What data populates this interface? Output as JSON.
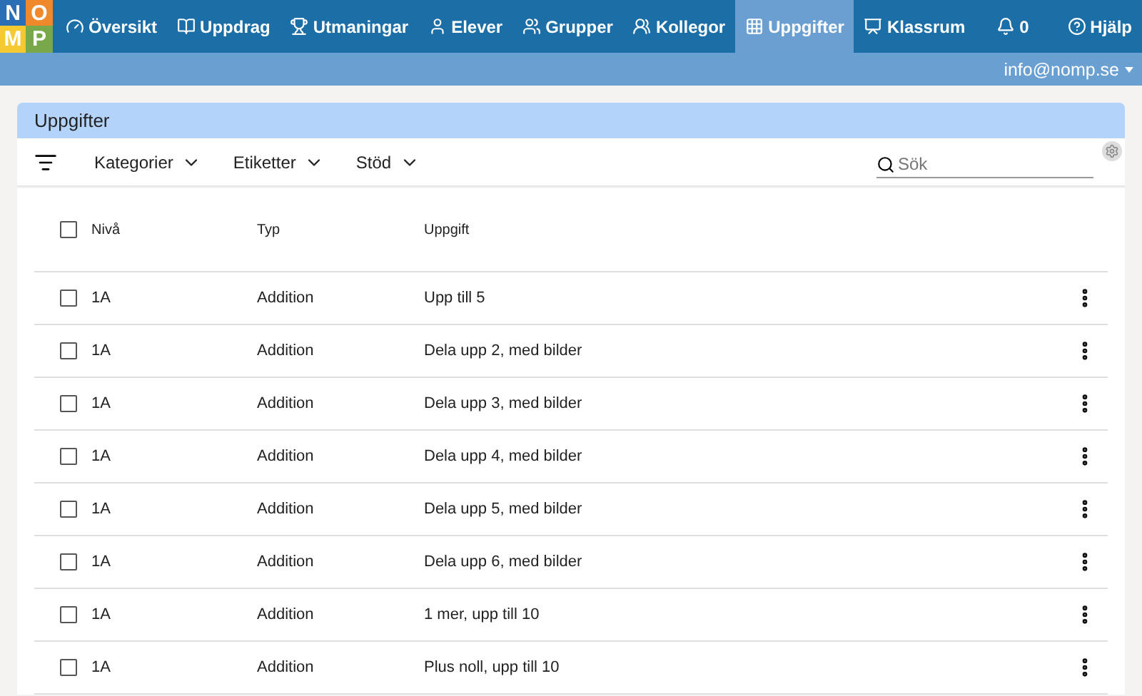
{
  "logo": {
    "letters": [
      "N",
      "O",
      "M",
      "P"
    ]
  },
  "nav": {
    "items": [
      {
        "label": "Översikt",
        "selected": false
      },
      {
        "label": "Uppdrag",
        "selected": false
      },
      {
        "label": "Utmaningar",
        "selected": false
      },
      {
        "label": "Elever",
        "selected": false
      },
      {
        "label": "Grupper",
        "selected": false
      },
      {
        "label": "Kollegor",
        "selected": false
      },
      {
        "label": "Uppgifter",
        "selected": true
      },
      {
        "label": "Klassrum",
        "selected": false
      },
      {
        "label": "0",
        "selected": false
      }
    ],
    "help": "Hjälp"
  },
  "account": "info@nomp.se",
  "panel": {
    "title": "Uppgifter",
    "filters": [
      "Kategorier",
      "Etiketter",
      "Stöd"
    ],
    "search": {
      "placeholder": "Sök"
    }
  },
  "table": {
    "columns": [
      "Nivå",
      "Typ",
      "Uppgift"
    ],
    "all_checked": false,
    "rows": [
      {
        "level": "1A",
        "type": "Addition",
        "task": "Upp till 5",
        "checked": false
      },
      {
        "level": "1A",
        "type": "Addition",
        "task": "Dela upp 2, med bilder",
        "checked": false
      },
      {
        "level": "1A",
        "type": "Addition",
        "task": "Dela upp 3, med bilder",
        "checked": false
      },
      {
        "level": "1A",
        "type": "Addition",
        "task": "Dela upp 4, med bilder",
        "checked": false
      },
      {
        "level": "1A",
        "type": "Addition",
        "task": "Dela upp 5, med bilder",
        "checked": false
      },
      {
        "level": "1A",
        "type": "Addition",
        "task": "Dela upp 6, med bilder",
        "checked": false
      },
      {
        "level": "1A",
        "type": "Addition",
        "task": "1 mer, upp till 10",
        "checked": false
      },
      {
        "level": "1A",
        "type": "Addition",
        "task": "Plus noll, upp till 10",
        "checked": false
      }
    ]
  }
}
